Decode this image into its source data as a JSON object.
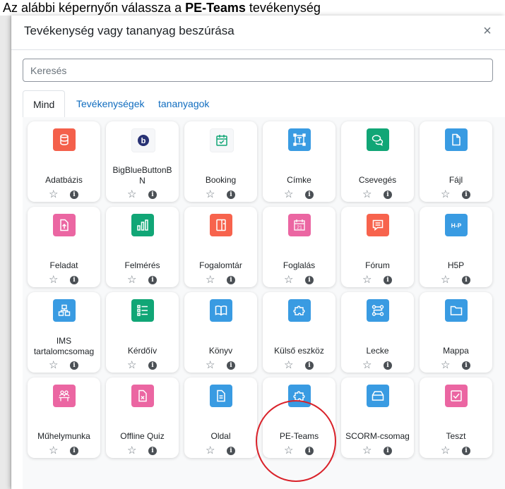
{
  "instruction": {
    "prefix": "Az alábbi képernyőn válassza a ",
    "bold": "PE-Teams",
    "suffix": " tevékenység"
  },
  "modal": {
    "title": "Tevékenység vagy tananyag beszúrása",
    "close": "×"
  },
  "search": {
    "placeholder": "Keresés",
    "value": ""
  },
  "tabs": [
    {
      "label": "Mind",
      "active": true
    },
    {
      "label": "Tevékenységek",
      "active": false
    },
    {
      "label": "tananyagok",
      "active": false
    }
  ],
  "colors": {
    "admin": "#f4604b",
    "communication": "#11a676",
    "content": "#399be2",
    "assessment": "#eb66a2",
    "collaboration": "#f7634d"
  },
  "cards": [
    {
      "label": "Adatbázis",
      "icon": "database-icon",
      "color": "#f4604b"
    },
    {
      "label": "BigBlueButtonBN",
      "icon": "bigbluebutton-icon",
      "color": "#ffffff"
    },
    {
      "label": "Booking",
      "icon": "calendar-check-icon",
      "color": "#ffffff"
    },
    {
      "label": "Címke",
      "icon": "text-label-icon",
      "color": "#399be2"
    },
    {
      "label": "Csevegés",
      "icon": "chat-icon",
      "color": "#11a676"
    },
    {
      "label": "Fájl",
      "icon": "file-icon",
      "color": "#399be2"
    },
    {
      "label": "Feladat",
      "icon": "assignment-upload-icon",
      "color": "#eb66a2"
    },
    {
      "label": "Felmérés",
      "icon": "bar-chart-icon",
      "color": "#11a676"
    },
    {
      "label": "Fogalomtár",
      "icon": "glossary-icon",
      "color": "#f7634d"
    },
    {
      "label": "Foglalás",
      "icon": "scheduler-calendar-icon",
      "color": "#eb66a2"
    },
    {
      "label": "Fórum",
      "icon": "forum-icon",
      "color": "#f7634d"
    },
    {
      "label": "H5P",
      "icon": "h5p-icon",
      "color": "#399be2"
    },
    {
      "label": "IMS tartalomcsomag",
      "icon": "ims-package-icon",
      "color": "#399be2"
    },
    {
      "label": "Kérdőív",
      "icon": "questionnaire-icon",
      "color": "#11a676"
    },
    {
      "label": "Könyv",
      "icon": "book-icon",
      "color": "#399be2"
    },
    {
      "label": "Külső eszköz",
      "icon": "puzzle-icon",
      "color": "#399be2"
    },
    {
      "label": "Lecke",
      "icon": "lesson-icon",
      "color": "#399be2"
    },
    {
      "label": "Mappa",
      "icon": "folder-icon",
      "color": "#399be2"
    },
    {
      "label": "Műhelymunka",
      "icon": "workshop-icon",
      "color": "#eb66a2"
    },
    {
      "label": "Offline Quiz",
      "icon": "offline-quiz-icon",
      "color": "#eb66a2"
    },
    {
      "label": "Oldal",
      "icon": "page-icon",
      "color": "#399be2"
    },
    {
      "label": "PE-Teams",
      "icon": "puzzle-icon",
      "color": "#399be2"
    },
    {
      "label": "SCORM-csomag",
      "icon": "scorm-icon",
      "color": "#399be2"
    },
    {
      "label": "Teszt",
      "icon": "quiz-check-icon",
      "color": "#eb66a2"
    }
  ],
  "card_actions": {
    "star": "☆",
    "info": "i"
  }
}
